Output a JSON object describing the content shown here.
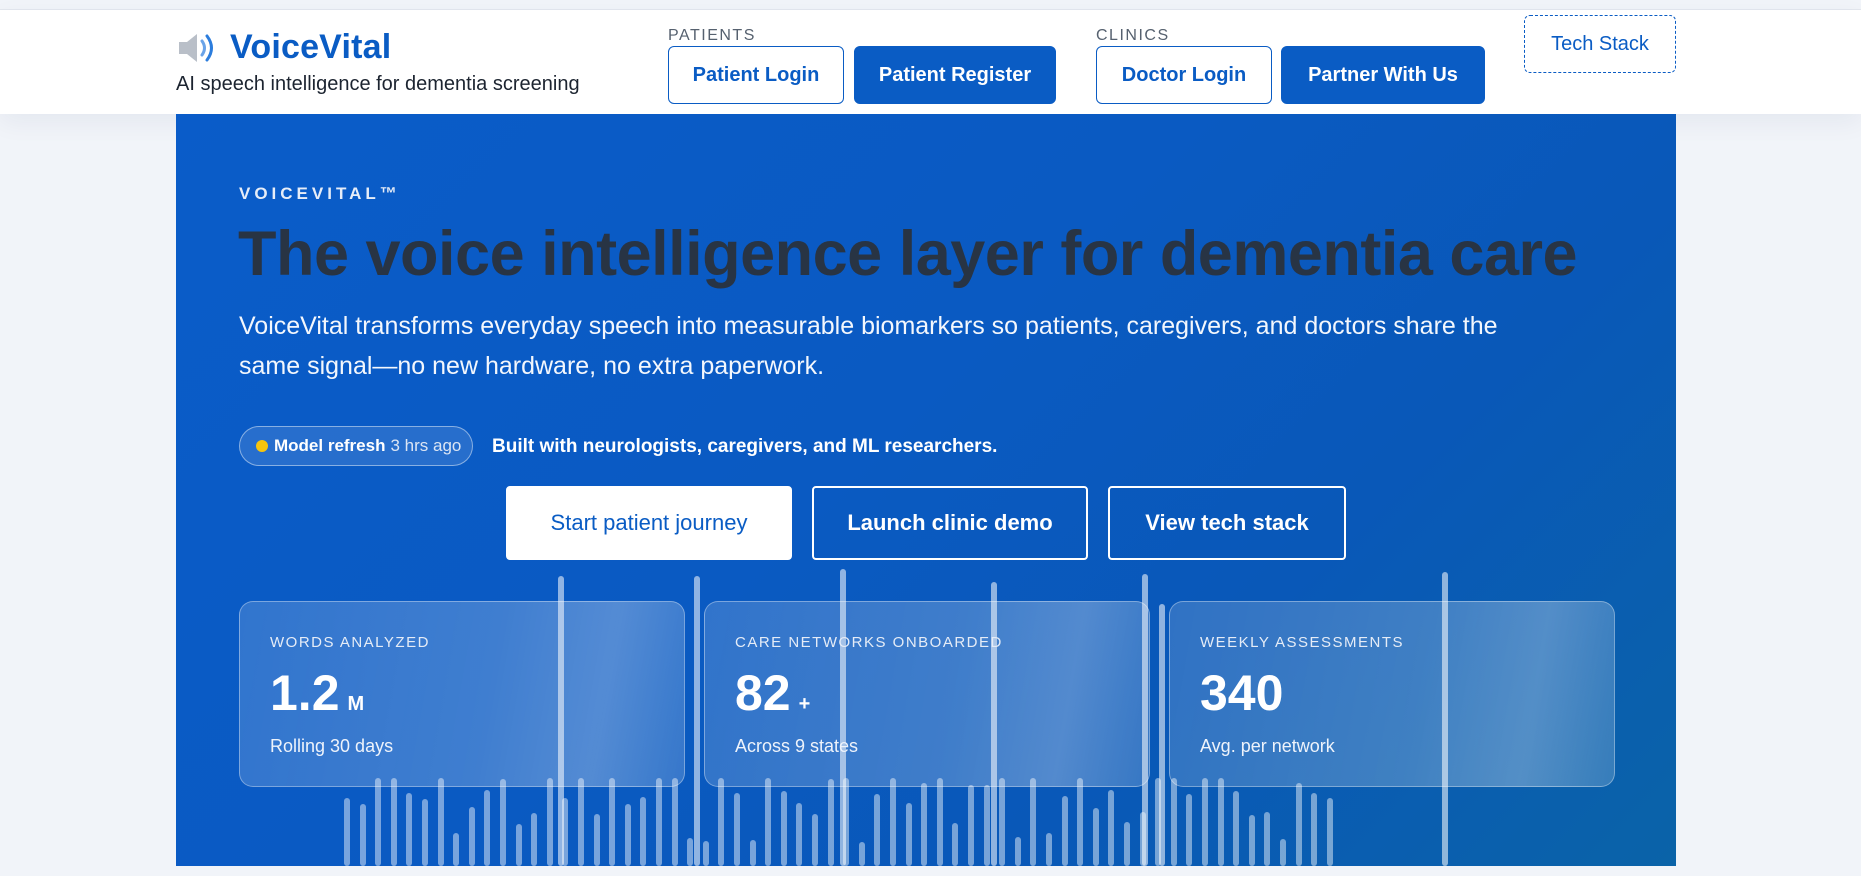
{
  "header": {
    "brand_name": "VoiceVital",
    "brand_icon": "speaker-icon",
    "tagline": "AI speech intelligence for dementia screening",
    "patients_label": "PATIENTS",
    "patient_login": "Patient Login",
    "patient_register": "Patient Register",
    "clinics_label": "CLINICS",
    "doctor_login": "Doctor Login",
    "partner": "Partner With Us",
    "tech_stack": "Tech Stack"
  },
  "hero": {
    "eyebrow": "VOICEVITAL™",
    "headline": "The voice intelligence layer for dementia care",
    "lede": "VoiceVital transforms everyday speech into measurable biomarkers so patients, caregivers, and doctors share the same signal—no new hardware, no extra paperwork.",
    "pill_strong": "Model refresh",
    "pill_time": "3 hrs ago",
    "built_with": "Built with neurologists, caregivers, and ML researchers.",
    "cta_primary": "Start patient journey",
    "cta_clinic": "Launch clinic demo",
    "cta_tech": "View tech stack"
  },
  "stats": [
    {
      "label": "WORDS ANALYZED",
      "value": "1.2",
      "suffix": "M",
      "sub": "Rolling 30 days"
    },
    {
      "label": "CARE NETWORKS ONBOARDED",
      "value": "82",
      "suffix": "+",
      "sub": "Across 9 states"
    },
    {
      "label": "WEEKLY ASSESSMENTS",
      "value": "340",
      "suffix": "",
      "sub": "Avg. per network"
    }
  ],
  "colors": {
    "brand": "#0a5cc4",
    "hero_bg": "#0a5cc9",
    "headline": "#283444",
    "status_dot": "#f6c50e"
  }
}
